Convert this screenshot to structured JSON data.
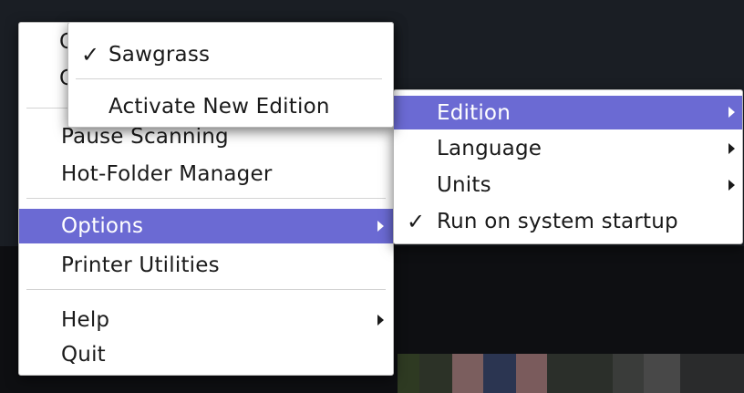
{
  "main_menu": {
    "items": [
      {
        "label": "Pause Scanning"
      },
      {
        "label": "Hot-Folder Manager"
      },
      {
        "label": "Options"
      },
      {
        "label": "Printer Utilities"
      },
      {
        "label": "Help"
      },
      {
        "label": "Quit"
      }
    ],
    "partial_hidden": [
      "C",
      "C"
    ]
  },
  "edition_menu": {
    "items": [
      {
        "label": "Sawgrass",
        "checked": true
      },
      {
        "label": "Activate New Edition"
      }
    ]
  },
  "options_menu": {
    "items": [
      {
        "label": "Edition"
      },
      {
        "label": "Language"
      },
      {
        "label": "Units"
      },
      {
        "label": "Run on system startup",
        "checked": true
      }
    ]
  },
  "glyphs": {
    "check": "✓"
  },
  "colors": {
    "highlight": "#6b6ad3",
    "menu_bg": "#ffffff",
    "text": "#1a1a1a"
  }
}
